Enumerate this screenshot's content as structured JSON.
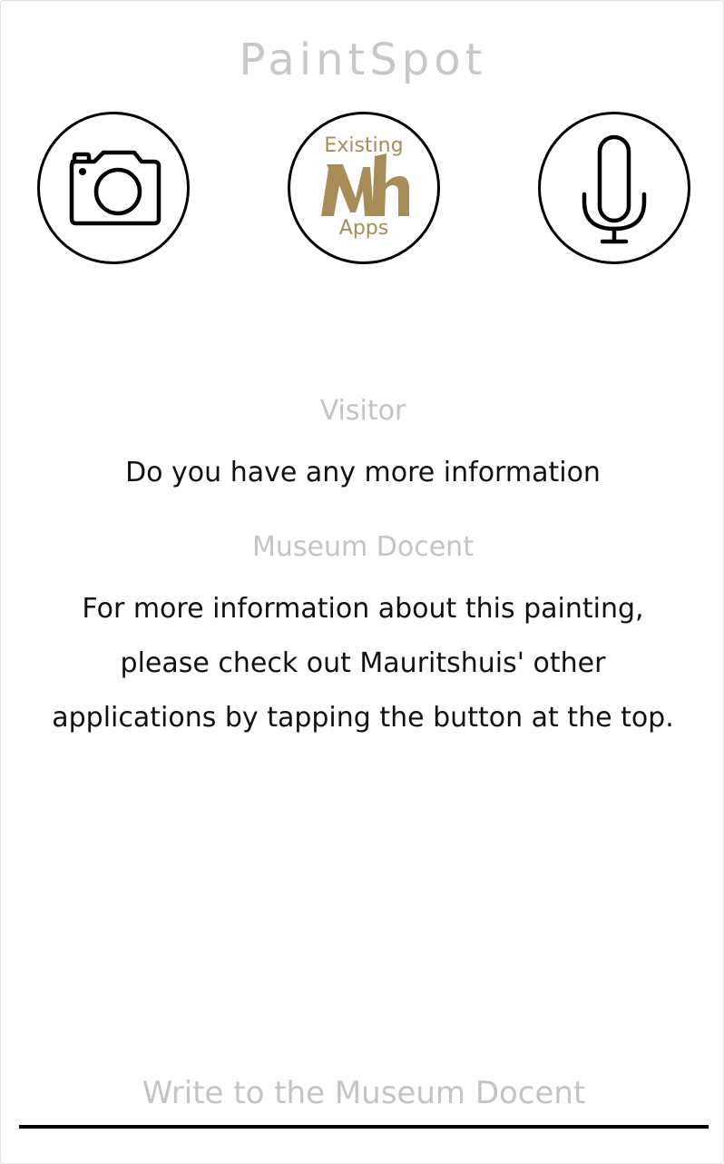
{
  "app": {
    "title": "PaintSpot"
  },
  "toolbar": {
    "camera_icon": "camera-icon",
    "apps_button": {
      "top_label": "Existing",
      "logo_text": "Mh",
      "bottom_label": "Apps",
      "logo_color": "#a88c57"
    },
    "mic_icon": "microphone-icon"
  },
  "conversation": [
    {
      "speaker": "Visitor",
      "text": "Do you have any more information"
    },
    {
      "speaker": "Museum Docent",
      "text": "For more information about this painting, please check out Mauritshuis' other applications by tapping the button at the top."
    }
  ],
  "composer": {
    "placeholder": "Write to the Museum Docent",
    "value": ""
  },
  "colors": {
    "title": "#c8c8c8",
    "speaker": "#c4c4c4",
    "message": "#111111",
    "accent_gold": "#a88c57",
    "border": "#000000"
  }
}
